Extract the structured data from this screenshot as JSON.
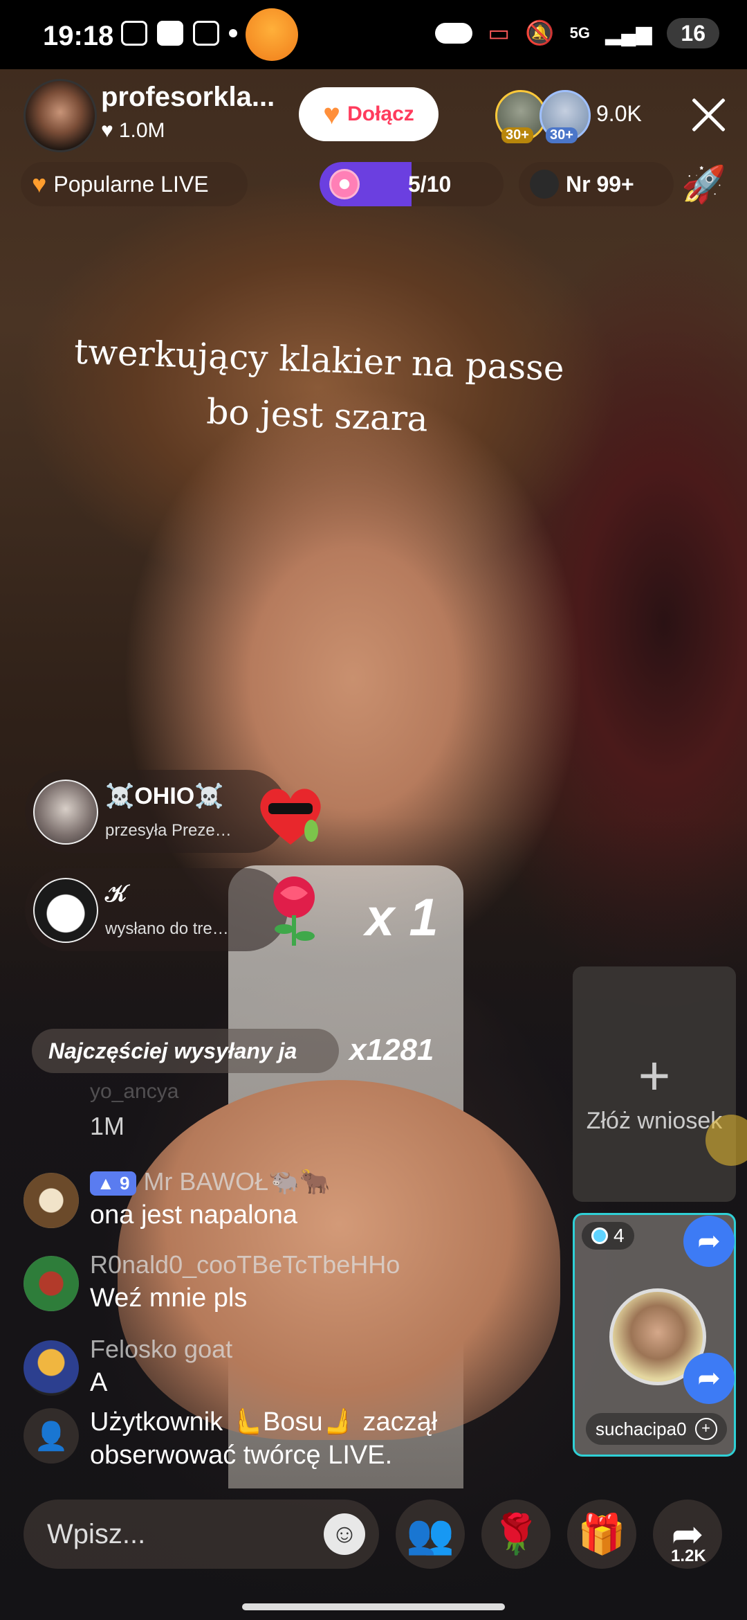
{
  "status_bar": {
    "time": "19:18",
    "battery": "16",
    "network": "5G"
  },
  "host": {
    "name": "profesorkla...",
    "likes": "1.0M",
    "join_label": "Dołącz"
  },
  "viewers": {
    "badge_1": "30+",
    "badge_2": "30+",
    "count": "9.0K"
  },
  "chips": {
    "popular": "Popularne LIVE",
    "progress": "5/10",
    "progress_value": 0.5,
    "rank": "Nr 99+"
  },
  "overlay_text": {
    "line1": "twerkujący klakier na passe",
    "line2": "bo jest szara"
  },
  "gifts": [
    {
      "user": "☠️OHIO☠️",
      "sub": "przesyła Prezent (...",
      "count": ""
    },
    {
      "user": "𝒦",
      "sub": "wysłano do treści ...",
      "count": "x 1"
    }
  ],
  "most_sent": {
    "label": "Najczęściej wysyłany ja",
    "count": "x1281"
  },
  "chat": {
    "faded_name": "yo_ancya",
    "faded_msg": "1M",
    "messages": [
      {
        "level": "9",
        "name": "Mr BAWOŁ🐃🐂",
        "msg": "ona jest napalona"
      },
      {
        "name": "R0nald0_cooTBeTcTbeHHo",
        "msg": "Weź mnie pls"
      },
      {
        "name": "Felosko goat",
        "msg": "A"
      }
    ],
    "follow_notice": "Użytkownik 🫷Bosu🫸 zaczął obserwować twórcę LIVE."
  },
  "request_box": {
    "label": "Złóż wniosek"
  },
  "guest": {
    "level": "4",
    "name": "suchacipa0"
  },
  "bottom": {
    "placeholder": "Wpisz...",
    "share_count": "1.2K"
  },
  "colors": {
    "accent": "#ff3b5c",
    "progress": "#6b3fe0",
    "guest_border": "#2fd0d6",
    "share": "#3d7bf5"
  }
}
